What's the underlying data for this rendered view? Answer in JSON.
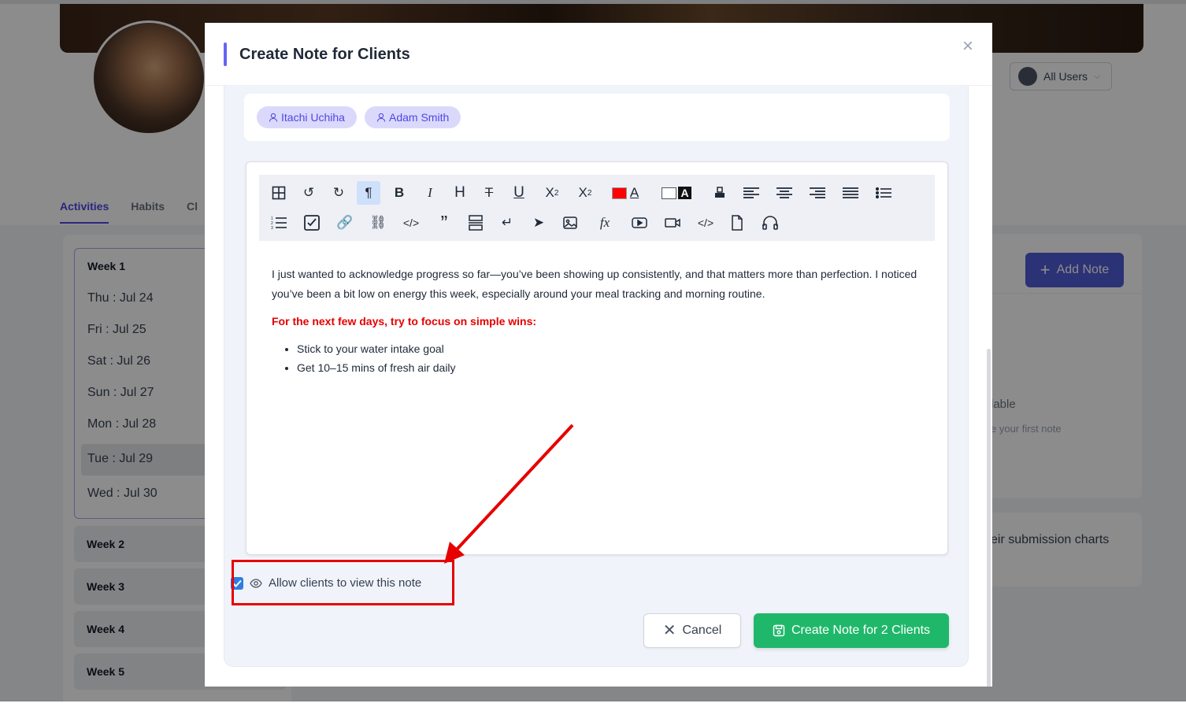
{
  "background": {
    "user_filter": "All Users",
    "tabs": [
      "Activities",
      "Habits",
      "Cl"
    ],
    "week1": {
      "title": "Week 1",
      "days": [
        "Thu : Jul 24",
        "Fri : Jul 25",
        "Sat : Jul 26",
        "Sun : Jul 27",
        "Mon : Jul 28",
        "Tue : Jul 29",
        "Wed : Jul 30"
      ],
      "selected_day": "Tue : Jul 29"
    },
    "weeks": [
      "Week 2",
      "Week 3",
      "Week 4",
      "Week 5"
    ],
    "add_note": "Add Note",
    "empty_partial": "lable",
    "empty_hint_partial": "e your first note",
    "charts_partial": "eir submission charts"
  },
  "modal": {
    "title": "Create Note for Clients",
    "recipients": [
      "Itachi Uchiha",
      "Adam Smith"
    ],
    "toolbar_icons": [
      "table-icon",
      "undo-icon",
      "redo-icon",
      "paragraph-icon",
      "bold-icon",
      "italic-icon",
      "heading-icon",
      "strikethrough-icon",
      "underline-icon",
      "subscript-icon",
      "superscript-icon",
      "font-color-icon",
      "highlight-color-icon",
      "remove-format-icon",
      "align-left-icon",
      "align-center-icon",
      "align-right-icon",
      "align-justify-icon",
      "bullet-list-icon",
      "ordered-list-icon",
      "checklist-icon",
      "link-icon",
      "unlink-icon",
      "code-icon",
      "blockquote-icon",
      "horizontal-rule-icon",
      "line-break-icon",
      "send-icon",
      "image-icon",
      "formula-icon",
      "youtube-icon",
      "video-icon",
      "embed-code-icon",
      "attachment-icon",
      "audio-icon"
    ],
    "font_color": "#ff0000",
    "content": {
      "paragraph": "I just wanted to acknowledge progress so far—you’ve been showing up consistently, and that matters more than perfection. I noticed you’ve been a bit low on energy this week, especially around your meal tracking and morning routine.",
      "highlight": "For the next few days, try to focus on simple wins:",
      "bullets": [
        "Stick to your water intake goal",
        "Get 10–15 mins of fresh air daily"
      ]
    },
    "allow_clients_label": "Allow clients to view this note",
    "allow_clients_checked": true,
    "cancel_label": "Cancel",
    "create_label": "Create Note for 2 Clients"
  },
  "colors": {
    "accent": "#6366f1",
    "create_button": "#1fb86a",
    "annotation": "#e60000"
  }
}
